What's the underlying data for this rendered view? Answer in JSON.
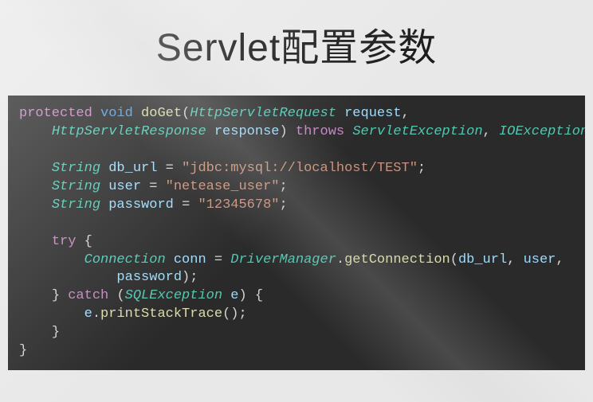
{
  "title": "Servlet配置参数",
  "code": {
    "kw_protected": "protected",
    "kw_void": "void",
    "kw_throws": "throws",
    "kw_try": "try",
    "kw_catch": "catch",
    "method_doGet": "doGet",
    "type_HttpServletRequest": "HttpServletRequest",
    "type_HttpServletResponse": "HttpServletResponse",
    "type_ServletException": "ServletException",
    "type_IOException": "IOException",
    "type_String": "String",
    "type_Connection": "Connection",
    "type_DriverManager": "DriverManager",
    "type_SQLException": "SQLException",
    "var_request": "request",
    "var_response": "response",
    "var_db_url": "db_url",
    "var_user": "user",
    "var_password": "password",
    "var_conn": "conn",
    "var_e": "e",
    "str_db_url": "\"jdbc:mysql://localhost/TEST\"",
    "str_user": "\"netease_user\"",
    "str_password": "\"12345678\"",
    "call_getConnection": "getConnection",
    "call_printStackTrace": "printStackTrace"
  }
}
